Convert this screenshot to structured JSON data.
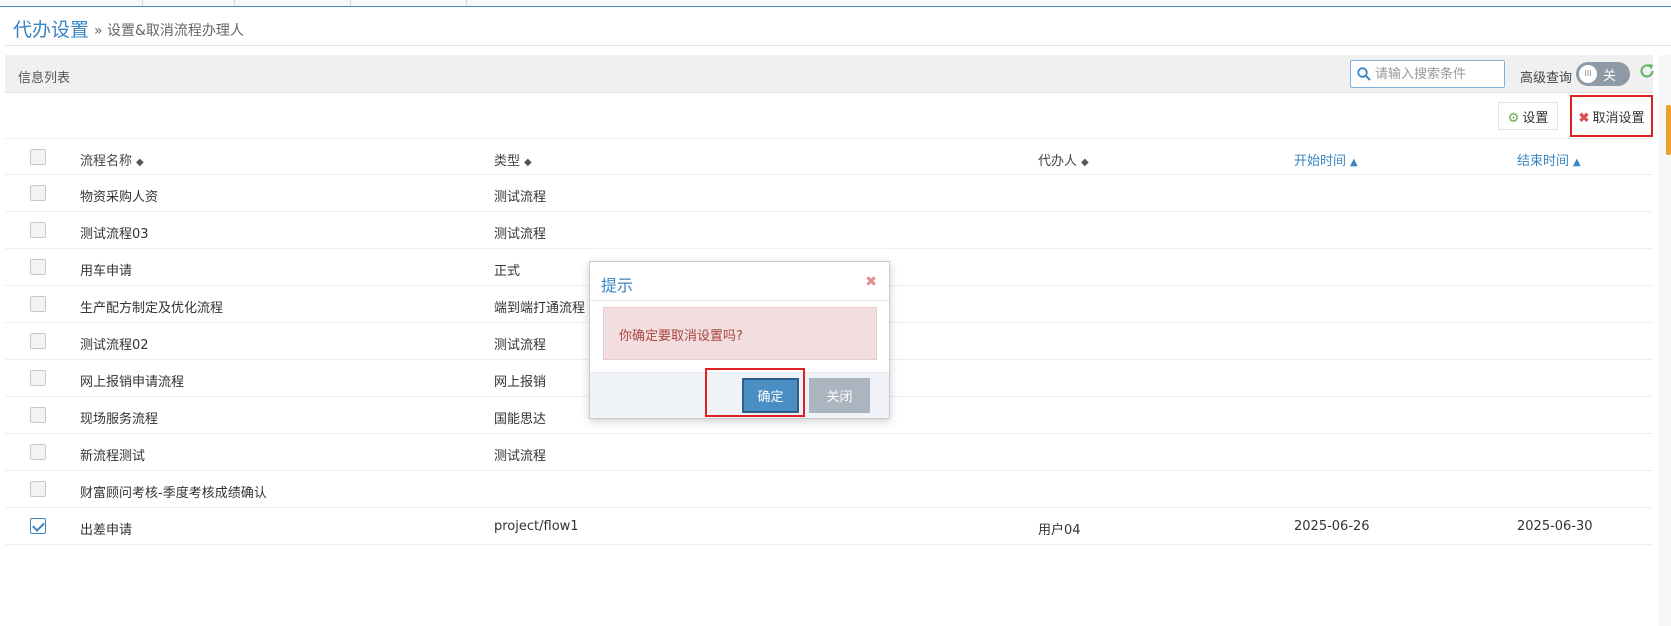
{
  "header": {
    "title": "代办设置",
    "breadcrumb": "» 设置&取消流程办理人"
  },
  "panel": {
    "label": "信息列表",
    "search_placeholder": "请输入搜索条件",
    "advanced_label": "高级查询",
    "toggle_state": "关",
    "toggle_knob": "III"
  },
  "toolbar": {
    "set_label": "设置",
    "cancel_label": "取消设置"
  },
  "table": {
    "columns": [
      "流程名称",
      "类型",
      "代办人",
      "开始时间",
      "结束时间"
    ],
    "rows": [
      {
        "name": "物资采购人资",
        "type": "测试流程",
        "agent": "",
        "start": "",
        "end": "",
        "checked": false
      },
      {
        "name": "测试流程03",
        "type": "测试流程",
        "agent": "",
        "start": "",
        "end": "",
        "checked": false
      },
      {
        "name": "用车申请",
        "type": "正式",
        "agent": "",
        "start": "",
        "end": "",
        "checked": false
      },
      {
        "name": "生产配方制定及优化流程",
        "type": "端到端打通流程",
        "agent": "",
        "start": "",
        "end": "",
        "checked": false
      },
      {
        "name": "测试流程02",
        "type": "测试流程",
        "agent": "",
        "start": "",
        "end": "",
        "checked": false
      },
      {
        "name": "网上报销申请流程",
        "type": "网上报销",
        "agent": "",
        "start": "",
        "end": "",
        "checked": false
      },
      {
        "name": "现场服务流程",
        "type": "国能思达",
        "agent": "",
        "start": "",
        "end": "",
        "checked": false
      },
      {
        "name": "新流程测试",
        "type": "测试流程",
        "agent": "",
        "start": "",
        "end": "",
        "checked": false
      },
      {
        "name": "财富顾问考核-季度考核成绩确认",
        "type": "",
        "agent": "",
        "start": "",
        "end": "",
        "checked": false
      },
      {
        "name": "出差申请",
        "type": "project/flow1",
        "agent": "用户04",
        "start": "2025-06-26",
        "end": "2025-06-30",
        "checked": true
      }
    ]
  },
  "dialog": {
    "title": "提示",
    "close_glyph": "✖",
    "message": "你确定要取消设置吗?",
    "confirm_label": "确定",
    "close_label": "关闭"
  },
  "colors": {
    "accent": "#3a84c4",
    "highlight_red": "#e02020",
    "alert_bg": "#f2dede",
    "alert_text": "#a94442"
  }
}
